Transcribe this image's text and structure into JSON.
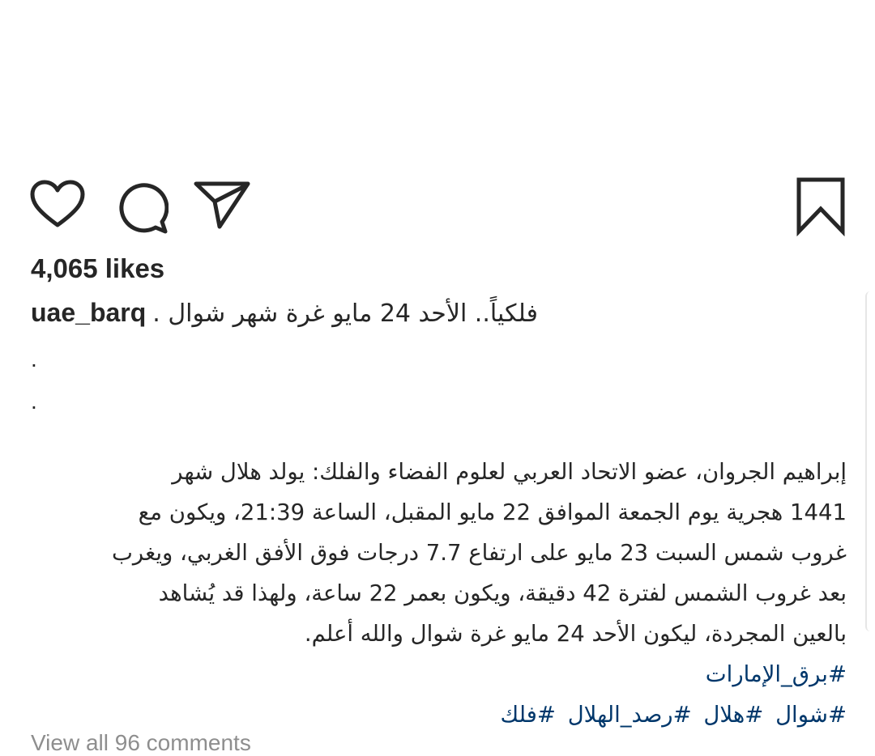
{
  "actions": {
    "like_icon": "heart-icon",
    "comment_icon": "comment-icon",
    "share_icon": "paper-plane-icon",
    "save_icon": "bookmark-icon"
  },
  "post": {
    "likes_text": "4,065 likes",
    "username": "uae_barq",
    "headline": "فلكياً.. الأحد 24 مايو غرة شهر شوال .",
    "dots": [
      ".",
      "."
    ],
    "body_lines": [
      "إبراهيم الجروان، عضو الاتحاد العربي لعلوم الفضاء والفلك: يولد هلال شهر",
      "1441 هجرية يوم الجمعة الموافق 22 مايو المقبل، الساعة 21:39، ويكون مع",
      "غروب شمس السبت 23 مايو على ارتفاع 7.7 درجات فوق الأفق الغربي، ويغرب",
      "بعد غروب الشمس لفترة 42 دقيقة، ويكون بعمر 22 ساعة، ولهذا قد يُشاهد",
      "بالعين المجردة، ليكون الأحد 24 مايو غرة شوال والله أعلم."
    ],
    "hashtags_line1": [
      "#برق_الإمارات"
    ],
    "hashtags_line2": [
      "#شوال",
      "#هلال",
      "#رصد_الهلال",
      "#فلك"
    ],
    "view_comments": "View all 96 comments"
  },
  "colors": {
    "text": "#262626",
    "hashtag": "#00376b",
    "muted": "#8e8e8e"
  }
}
